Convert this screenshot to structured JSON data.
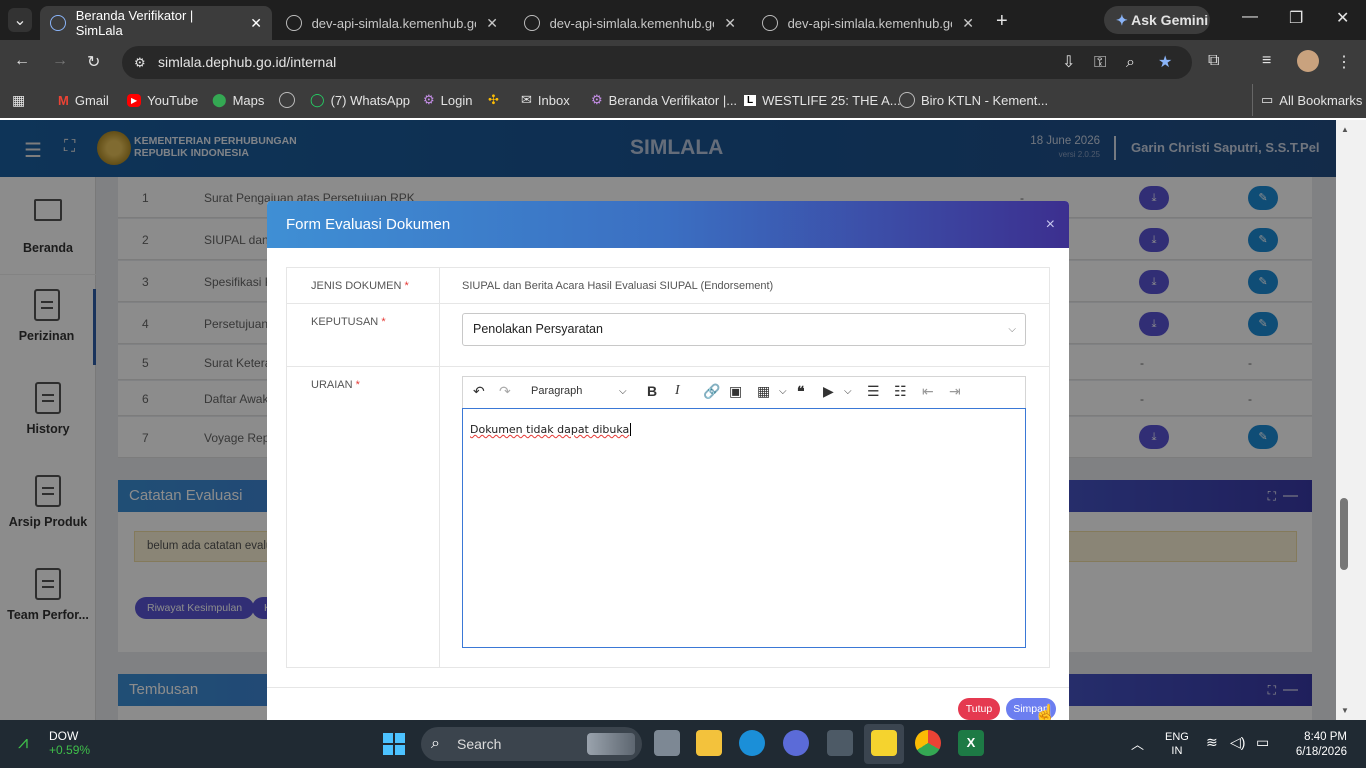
{
  "browser": {
    "tabs": [
      {
        "label": "Beranda Verifikator | SimLala",
        "active": true
      },
      {
        "label": "dev-api-simlala.kemenhub.go.id",
        "active": false
      },
      {
        "label": "dev-api-simlala.kemenhub.go.id",
        "active": false
      },
      {
        "label": "dev-api-simlala.kemenhub.go.id",
        "active": false
      }
    ],
    "ask_gemini": "Ask Gemini",
    "url": "simlala.dephub.go.id/internal",
    "bookmarks": [
      "Gmail",
      "YouTube",
      "Maps",
      "",
      "(7) WhatsApp",
      "Login",
      "",
      "Inbox",
      "Beranda Verifikator |...",
      "WESTLIFE 25: THE A...",
      "Biro KTLN - Kement..."
    ],
    "all_bookmarks": "All Bookmarks"
  },
  "app": {
    "org_line1": "KEMENTERIAN PERHUBUNGAN",
    "org_line2": "REPUBLIK INDONESIA",
    "title": "SIMLALA",
    "date": "18 June 2026",
    "version": "versi 2.0.25",
    "user": "Garin Christi Saputri, S.S.T.Pel"
  },
  "sidebar": {
    "items": [
      {
        "label": "Beranda",
        "icon": "monitor-icon"
      },
      {
        "label": "Perizinan",
        "icon": "document-icon"
      },
      {
        "label": "History",
        "icon": "document-icon"
      },
      {
        "label": "Arsip Produk",
        "icon": "document-icon"
      },
      {
        "label": "Team Perfor...",
        "icon": "document-icon"
      }
    ]
  },
  "documents": {
    "rows": [
      {
        "no": "1",
        "name": "Surat Pengajuan atas Persetujuan RPK",
        "status": "-"
      },
      {
        "no": "2",
        "name": "SIUPAL dan B",
        "status": ""
      },
      {
        "no": "3",
        "name": "Spesifikasi K",
        "status": ""
      },
      {
        "no": "4",
        "name": "Persetujuan S",
        "status": ""
      },
      {
        "no": "5",
        "name": "Surat Keteran",
        "status": "-"
      },
      {
        "no": "6",
        "name": "Daftar Awak",
        "status": "-"
      },
      {
        "no": "7",
        "name": "Voyage Repo",
        "status": ""
      }
    ],
    "dash": "-"
  },
  "catatan": {
    "title": "Catatan Evaluasi",
    "empty_text": "belum ada catatan evalu",
    "riwayat_button": "Riwayat Kesimpulan",
    "other_button": "K"
  },
  "tembusan": {
    "title": "Tembusan"
  },
  "modal": {
    "title": "Form Evaluasi Dokumen",
    "close": "×",
    "jenis_label": "JENIS DOKUMEN",
    "jenis_value": "SIUPAL dan Berita Acara Hasil Evaluasi SIUPAL (Endorsement)",
    "keputusan_label": "KEPUTUSAN",
    "keputusan_value": "Penolakan Persyaratan",
    "uraian_label": "URAIAN",
    "required_mark": "*",
    "editor_format": "Paragraph",
    "editor_text": "Dokumen tidak dapat  dibuka",
    "tutup_button": "Tutup",
    "simpan_button": "Simpan"
  },
  "taskbar": {
    "stock_name": "DOW",
    "stock_change": "+0.59%",
    "search_placeholder": "Search",
    "lang1": "ENG",
    "lang2": "IN",
    "time": "8:40 PM",
    "date": "6/18/2026"
  },
  "colors": {
    "header_blue": "#1b5fa0",
    "modal_gradient_start": "#3f8fd4",
    "modal_gradient_end": "#3c2f8f",
    "primary_purple": "#5a55d6",
    "tutup_red": "#e53950",
    "simpan_blue": "#6c7ef0"
  }
}
